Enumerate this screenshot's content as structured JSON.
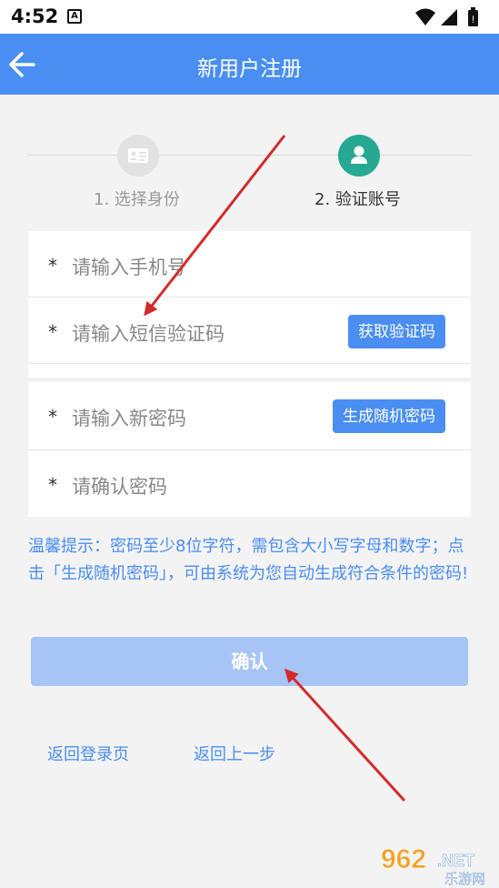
{
  "status_bar": {
    "time": "4:52",
    "notification_badge": "A"
  },
  "app_bar": {
    "title": "新用户注册"
  },
  "steps": [
    {
      "label": "1. 选择身份",
      "icon": "id-card-icon",
      "state": "done"
    },
    {
      "label": "2. 验证账号",
      "icon": "user-icon",
      "state": "active"
    }
  ],
  "form": {
    "phone_placeholder": "请输入手机号",
    "sms_placeholder": "请输入短信验证码",
    "get_code_button": "获取验证码",
    "new_password_placeholder": "请输入新密码",
    "random_password_button": "生成随机密码",
    "confirm_password_placeholder": "请确认密码",
    "required_mark": "*"
  },
  "tip": "温馨提示：密码至少8位字符，需包含大小写字母和数字；点击「生成随机密码」，可由系统为您自动生成符合条件的密码!",
  "confirm_button": "确认",
  "links": {
    "back_to_login": "返回登录页",
    "back_previous": "返回上一步"
  },
  "watermark": {
    "brand": "962",
    "suffix": ".NET",
    "site": "乐游网"
  },
  "colors": {
    "primary": "#4a8ef1",
    "step_active": "#27a892",
    "confirm_disabled": "#a6c5f6",
    "annotation_arrow": "#d42a2a"
  }
}
